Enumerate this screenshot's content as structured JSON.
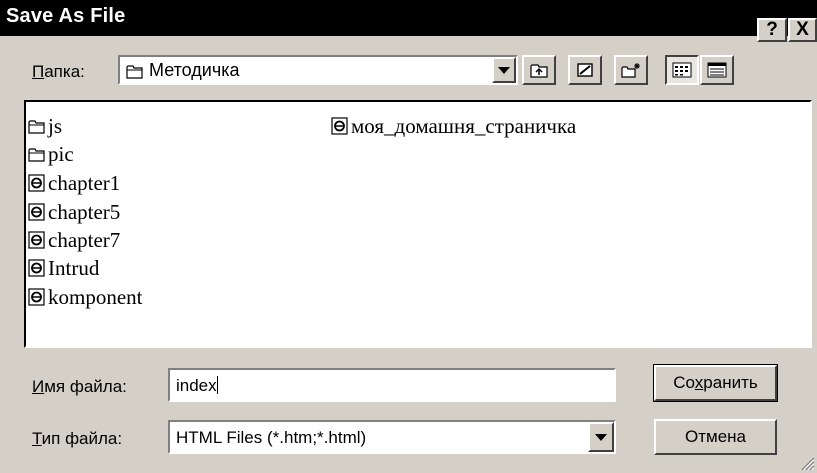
{
  "window": {
    "title": "Save As File",
    "help_label": "?",
    "close_label": "X"
  },
  "lookin": {
    "label": "Папка:",
    "accel": "П",
    "rest": "апка:",
    "value": "Методичка",
    "value_icon": "folder-icon"
  },
  "toolbar": {
    "buttons": [
      {
        "name": "up-one-level",
        "icon": "up-folder-icon"
      },
      {
        "name": "desktop",
        "icon": "desktop-icon"
      },
      {
        "name": "new-folder",
        "icon": "new-folder-icon"
      },
      {
        "name": "list-view",
        "icon": "list-view-icon"
      },
      {
        "name": "details-view",
        "icon": "details-view-icon"
      }
    ]
  },
  "files": [
    {
      "name": "js",
      "icon": "folder-icon"
    },
    {
      "name": "pic",
      "icon": "folder-icon"
    },
    {
      "name": "chapter1",
      "icon": "ie-document-icon"
    },
    {
      "name": "chapter5",
      "icon": "ie-document-icon"
    },
    {
      "name": "chapter7",
      "icon": "ie-document-icon"
    },
    {
      "name": "Intrud",
      "icon": "ie-document-icon"
    },
    {
      "name": "komponent",
      "icon": "ie-document-icon"
    },
    {
      "name": "моя_домашня_страничка",
      "icon": "ie-document-icon"
    }
  ],
  "filename": {
    "label_accel": "И",
    "label_rest": "мя файла:",
    "value": "index"
  },
  "filetype": {
    "label_accel": "Т",
    "label_rest": "ип файла:",
    "value": "HTML Files (*.htm;*.html)"
  },
  "buttons": {
    "save_pre": "Со",
    "save_accel": "х",
    "save_post": "ранить",
    "cancel": "Отмена"
  },
  "colors": {
    "face": "#d4d0c8",
    "titlebar": "#000000",
    "window": "#ffffff"
  }
}
